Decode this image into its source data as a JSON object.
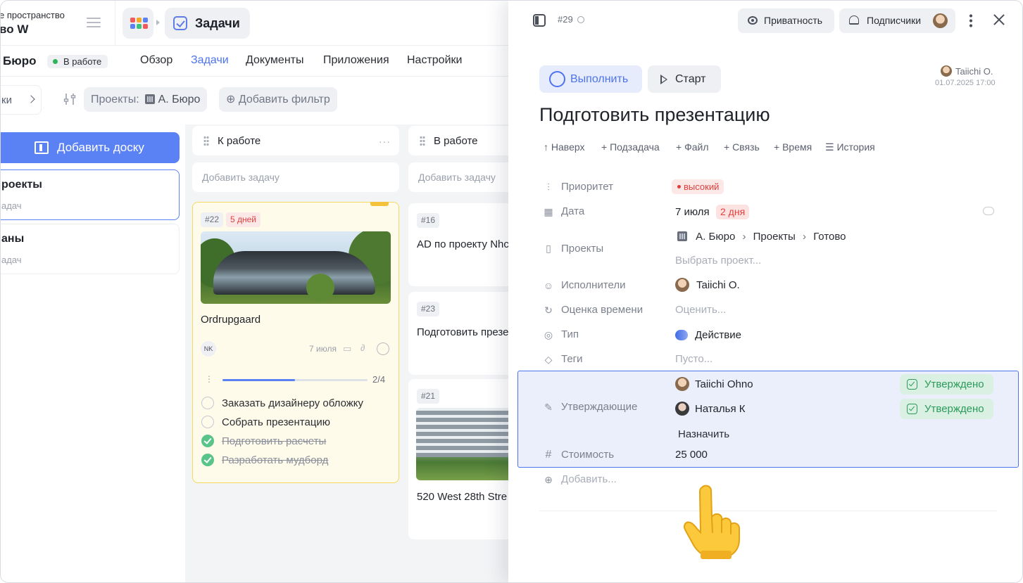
{
  "workspace": {
    "subtitle": "е пространство",
    "name": "во W"
  },
  "breadcrumb": {
    "current": "Задачи"
  },
  "project": {
    "name": "Бюро",
    "status": "В работе"
  },
  "nav_tabs": [
    "Обзор",
    "Задачи",
    "Документы",
    "Приложения",
    "Настройки"
  ],
  "filters": {
    "left_chip": "ки",
    "projects_label": "Проекты:",
    "projects_value": "А. Бюро",
    "add_filter": "Добавить фильтр"
  },
  "sidebar": {
    "add_board": "Добавить доску",
    "boards": [
      {
        "title": "роекты",
        "subtitle": "адач"
      },
      {
        "title": "аны",
        "subtitle": "адач"
      }
    ]
  },
  "columns": [
    {
      "title": "К работе",
      "menu": "···",
      "add_task": "Добавить задачу"
    },
    {
      "title": "В работе",
      "add_task": "Добавить задачу"
    }
  ],
  "card_main": {
    "id": "#22",
    "overdue": "5 дней",
    "title": "Ordrupgaard",
    "assignee": "NK",
    "date": "7 июля",
    "progress_text": "2/4",
    "progress": 0.5,
    "subtasks": [
      {
        "label": "Заказать дизайнеру обложку",
        "done": false
      },
      {
        "label": "Собрать презентацию",
        "done": false
      },
      {
        "label": "Подготовить расчеты",
        "done": true
      },
      {
        "label": "Разработать мудборд",
        "done": true
      }
    ]
  },
  "cards_col2": [
    {
      "id": "#16",
      "title": "AD по проекту Nhc"
    },
    {
      "id": "#23",
      "title": "Подготовить презе"
    },
    {
      "id": "#21",
      "title": "520 West 28th Stre"
    }
  ],
  "panel": {
    "task_no": "#29",
    "privacy": "Приватность",
    "subscribers": "Подписчики",
    "complete": "Выполнить",
    "start": "Старт",
    "author": "Taiichi O.",
    "author_date": "01.07.2025 17:00",
    "title": "Подготовить презентацию",
    "actions": [
      "↑ Наверх",
      "+ Подзадача",
      "+ Файл",
      "+ Связь",
      "+ Время",
      "☰ История"
    ],
    "props": {
      "priority_label": "Приоритет",
      "priority_value": "высокий",
      "date_label": "Дата",
      "date_value": "7 июля",
      "date_badge": "2 дня",
      "projects_label": "Проекты",
      "projects_path": [
        "А. Бюро",
        "Проекты",
        "Готово"
      ],
      "projects_placeholder": "Выбрать проект...",
      "assignees_label": "Исполнители",
      "assignee": "Taiichi O.",
      "estimate_label": "Оценка времени",
      "estimate_placeholder": "Оценить...",
      "type_label": "Тип",
      "type_value": "Действие",
      "tags_label": "Теги",
      "tags_placeholder": "Пусто...",
      "approvers_label": "Утверждающие",
      "approvers": [
        {
          "name": "Taiichi Ohno",
          "status": "Утверждено"
        },
        {
          "name": "Наталья К",
          "status": "Утверждено"
        }
      ],
      "assign": "Назначить",
      "cost_label": "Стоимость",
      "cost_value": "25 000",
      "add_prop": "Добавить..."
    }
  },
  "colors": {
    "accent": "#4d74ee",
    "danger": "#e0403c",
    "success": "#2b9a5b",
    "board_button": "#5b82f5"
  }
}
